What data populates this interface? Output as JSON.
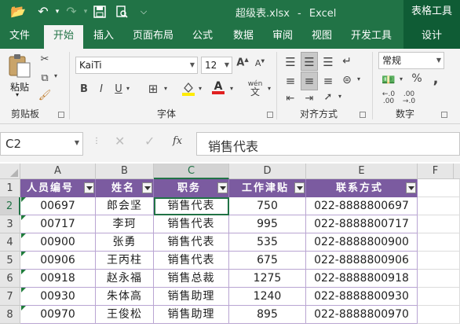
{
  "titlebar": {
    "filename": "超级表.xlsx",
    "separator": "-",
    "app": "Excel",
    "context_tab_group": "表格工具",
    "icons": [
      "open-icon",
      "undo-icon",
      "redo-icon",
      "save-icon",
      "print-preview-icon",
      "customize-toolbar-icon"
    ]
  },
  "tabs": [
    "文件",
    "开始",
    "插入",
    "页面布局",
    "公式",
    "数据",
    "审阅",
    "视图",
    "开发工具",
    "设计"
  ],
  "active_tab": "开始",
  "ribbon": {
    "clipboard": {
      "paste_label": "粘贴",
      "group_label": "剪贴板"
    },
    "font": {
      "name": "KaiTi",
      "size": "12",
      "group_label": "字体",
      "bold": "B",
      "italic": "I",
      "underline": "U",
      "grow": "A",
      "shrink": "A",
      "color_letter": "A",
      "phonetic": "wén"
    },
    "alignment": {
      "group_label": "对齐方式"
    },
    "number": {
      "format": "常规",
      "group_label": "数字",
      "percent": "%",
      "comma": ","
    }
  },
  "formula_bar": {
    "name_box": "C2",
    "fx": "fx",
    "value": "销售代表"
  },
  "columns": [
    "A",
    "B",
    "C",
    "D",
    "E",
    "F"
  ],
  "selected_column": "C",
  "rows": [
    "1",
    "2",
    "3",
    "4",
    "5",
    "6",
    "7",
    "8"
  ],
  "selected_row": "2",
  "table": {
    "headers": [
      "人员编号",
      "姓名",
      "职务",
      "工作津贴",
      "联系方式"
    ],
    "rows": [
      [
        "00697",
        "郎会坚",
        "销售代表",
        "750",
        "022-8888800697"
      ],
      [
        "00717",
        "李珂",
        "销售代表",
        "995",
        "022-8888800717"
      ],
      [
        "00900",
        "张勇",
        "销售代表",
        "535",
        "022-8888800900"
      ],
      [
        "00906",
        "王丙柱",
        "销售代表",
        "675",
        "022-8888800906"
      ],
      [
        "00918",
        "赵永福",
        "销售总裁",
        "1275",
        "022-8888800918"
      ],
      [
        "00930",
        "朱体高",
        "销售助理",
        "1240",
        "022-8888800930"
      ],
      [
        "00970",
        "王俊松",
        "销售助理",
        "895",
        "022-8888800970"
      ]
    ],
    "header_color": "#7b5ba0",
    "band_color": "#ffffff"
  },
  "colors": {
    "excel_green": "#217346",
    "context_green": "#0f5c35"
  }
}
